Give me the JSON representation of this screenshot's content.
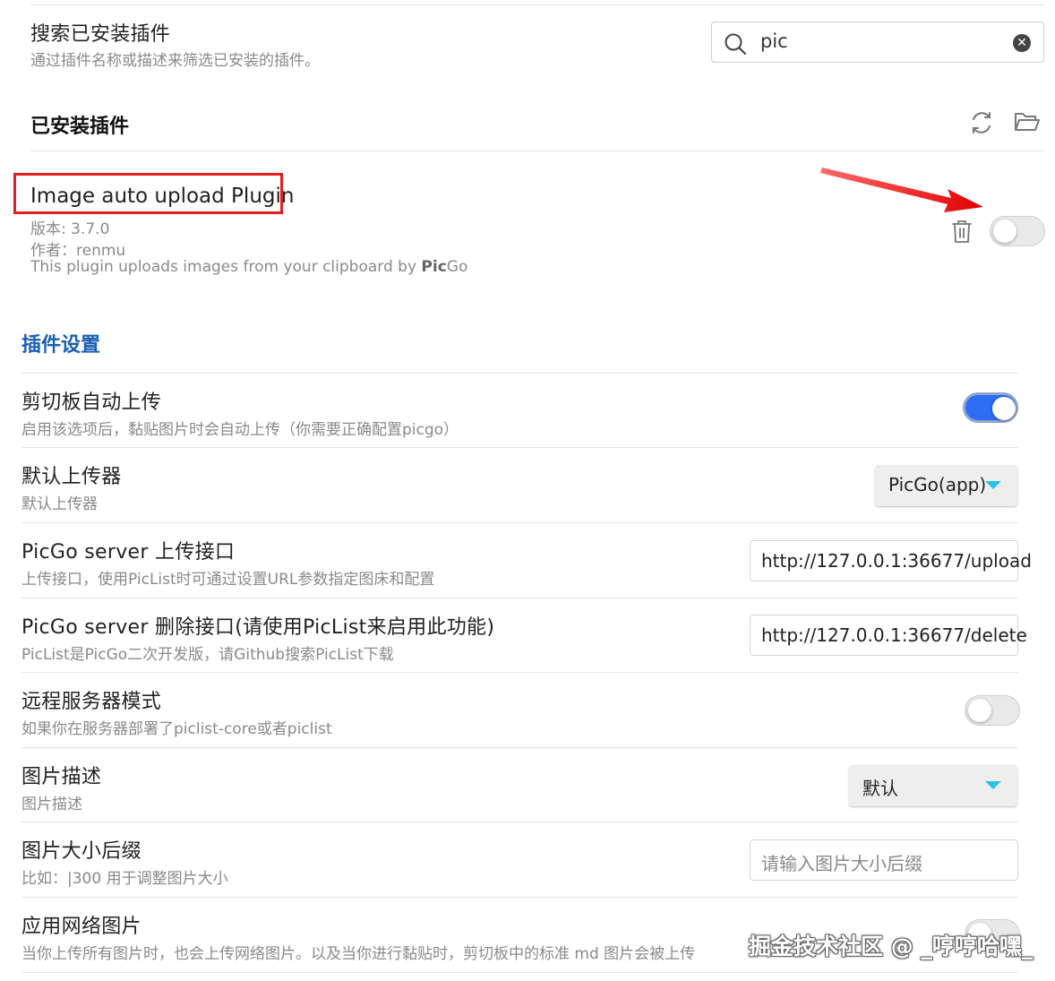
{
  "filter": {
    "title": "搜索已安装插件",
    "desc": "通过插件名称或描述来筛选已安装的插件。",
    "search_value": "pic"
  },
  "installed": {
    "title": "已安装插件",
    "reload_icon": "refresh-icon",
    "folder_icon": "folder-open-icon"
  },
  "plugin": {
    "name": "Image auto upload Plugin",
    "version": "版本: 3.7.0",
    "author": "作者：renmu",
    "desc_prefix": "This plugin uploads images from your clipboard by ",
    "desc_bold": "Pic",
    "desc_suffix": "Go",
    "enabled": false
  },
  "settings": {
    "heading": "插件设置",
    "items": [
      {
        "title": "剪切板自动上传",
        "desc": "启用该选项后，黏贴图片时会自动上传（你需要正确配置picgo）",
        "control": "toggle",
        "on": true
      },
      {
        "title": "默认上传器",
        "desc": "默认上传器",
        "control": "dropdown",
        "value": "PicGo(app)"
      },
      {
        "title": "PicGo server 上传接口",
        "desc": "上传接口，使用PicList时可通过设置URL参数指定图床和配置",
        "control": "input",
        "value": "http://127.0.0.1:36677/upload"
      },
      {
        "title": "PicGo server 删除接口(请使用PicList来启用此功能)",
        "desc": "PicList是PicGo二次开发版，请Github搜索PicList下载",
        "control": "input",
        "value": "http://127.0.0.1:36677/delete"
      },
      {
        "title": "远程服务器模式",
        "desc": "如果你在服务器部署了piclist-core或者piclist",
        "control": "toggle",
        "on": false
      },
      {
        "title": "图片描述",
        "desc": "图片描述",
        "control": "dropdown",
        "value": "默认"
      },
      {
        "title": "图片大小后缀",
        "desc": "比如：|300 用于调整图片大小",
        "control": "input",
        "placeholder": "请输入图片大小后缀"
      },
      {
        "title": "应用网络图片",
        "desc": "当你上传所有图片时，也会上传网络图片。以及当你进行黏贴时，剪切板中的标准 md 图片会被上传",
        "control": "toggle",
        "on": false
      }
    ]
  },
  "watermark": "掘金技术社区 @ _哼哼哈嘿_",
  "colors": {
    "accent": "#2e6cf6",
    "section_heading": "#1b5fb3",
    "highlight_box": "#e02020",
    "caret": "#29c3e6"
  }
}
